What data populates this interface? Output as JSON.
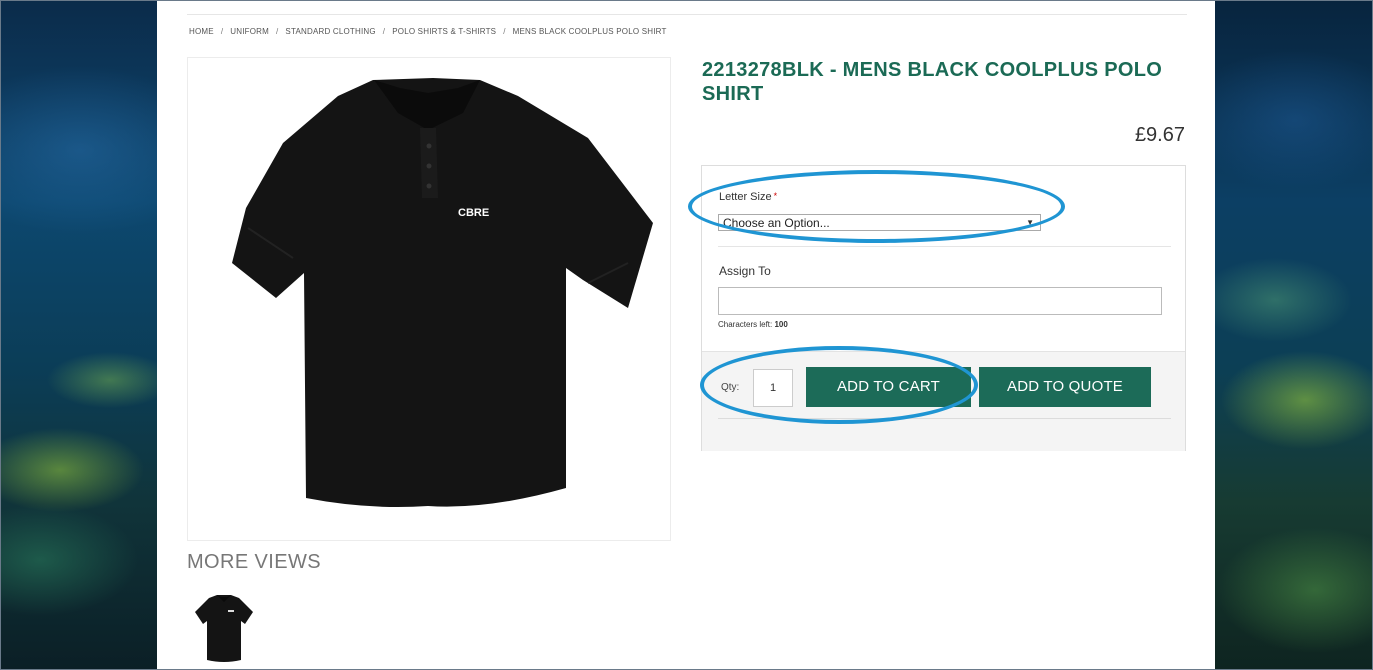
{
  "breadcrumb": {
    "items": [
      "HOME",
      "UNIFORM",
      "STANDARD CLOTHING",
      "POLO SHIRTS & T-SHIRTS",
      "MENS BLACK COOLPLUS POLO SHIRT"
    ],
    "separator": "/"
  },
  "product": {
    "title": "2213278BLK - MENS BLACK COOLPLUS POLO SHIRT",
    "price": "£9.67",
    "logo_text": "CBRE"
  },
  "options": {
    "letter_size_label": "Letter Size",
    "required_mark": "*",
    "select_value": "Choose an Option...",
    "assign_label": "Assign To",
    "assign_value": "",
    "chars_left_label": "Characters left:",
    "chars_left_value": "100"
  },
  "cart": {
    "qty_label": "Qty:",
    "qty_value": "1",
    "add_to_cart": "ADD TO CART",
    "add_to_quote": "ADD TO QUOTE"
  },
  "gallery": {
    "more_views_label": "MORE VIEWS"
  },
  "colors": {
    "brand_green": "#1c6b58",
    "highlight_blue": "#1f95d3"
  }
}
